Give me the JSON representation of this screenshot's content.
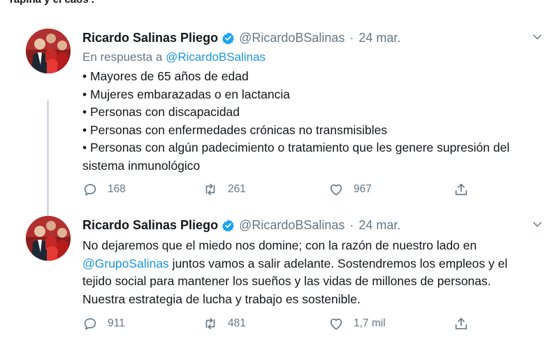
{
  "top_fragment": "rapiña y el caos .",
  "tweets": [
    {
      "author": "Ricardo Salinas Pliego",
      "handle": "@RicardoBSalinas",
      "separator": "·",
      "date": "24 mar.",
      "reply_prefix": "En respuesta a",
      "reply_handle": "@RicardoBSalinas",
      "bullets": [
        "• Mayores de 65 años de edad",
        "• Mujeres embarazadas o en lactancia",
        "• Personas con discapacidad",
        "• Personas con enfermedades crónicas no transmisibles",
        "• Personas con algún padecimiento o tratamiento que les genere supresión del sistema inmunológico"
      ],
      "replies": "168",
      "retweets": "261",
      "likes": "967"
    },
    {
      "author": "Ricardo Salinas Pliego",
      "handle": "@RicardoBSalinas",
      "separator": "·",
      "date": "24 mar.",
      "text_line1": "No dejaremos que el miedo nos domine; con la razón de nuestro lado en",
      "mention": "@GrupoSalinas",
      "text_line2_rest": " juntos vamos a salir adelante. Sostendremos los empleos y el",
      "text_line3": "tejido social para mantener los sueños y las vidas de millones de personas.",
      "text_line4": "Nuestra estrategia de lucha y trabajo es sostenible.",
      "replies": "911",
      "retweets": "481",
      "likes": "1,7 mil"
    }
  ],
  "colors": {
    "link": "#1b95e0",
    "muted": "#657786",
    "text": "#14171a",
    "verified": "#1da1f2",
    "thread_line": "#d2d9df"
  },
  "icons": [
    "verified-badge-icon",
    "chevron-down-icon",
    "reply-icon",
    "retweet-icon",
    "like-icon",
    "share-icon"
  ]
}
